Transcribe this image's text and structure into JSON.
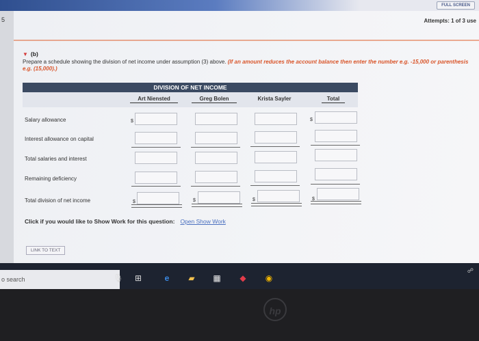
{
  "window": {
    "fullscreen_label": "FULL SCREEN",
    "attempts_text": "Attempts: 1 of 3 use",
    "left_number": "5"
  },
  "section": {
    "title": "(b)",
    "instruction_plain": "Prepare a schedule showing the division of net income under assumption (3) above.",
    "instruction_italic": "(If an amount reduces the account balance then enter the number e.g. -15,000 or parenthesis e.g. (15,000).)"
  },
  "table": {
    "title": "DIVISION OF NET INCOME",
    "columns": [
      "Art Niensted",
      "Greg Bolen",
      "Krista Sayler",
      "Total"
    ],
    "rows": [
      {
        "label": "Salary allowance",
        "value": ""
      },
      {
        "label": "Interest allowance on capital",
        "value": ""
      },
      {
        "label": "Total salaries and interest",
        "value": ""
      },
      {
        "label": "Remaining deficiency",
        "value": ""
      },
      {
        "label": "Total division of net income",
        "value": ""
      }
    ],
    "currency": "$"
  },
  "show_work": {
    "prompt": "Click if you would like to Show Work for this question:",
    "link": "Open Show Work"
  },
  "link_to_text": "LINK TO TEXT",
  "taskbar": {
    "search_placeholder": "o search"
  }
}
